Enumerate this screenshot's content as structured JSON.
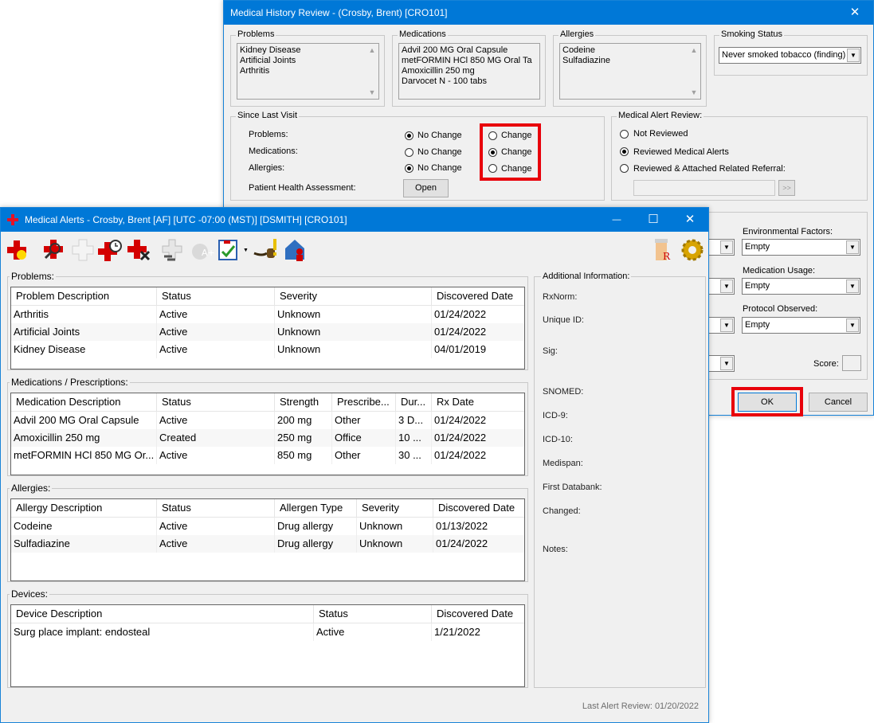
{
  "review": {
    "title": "Medical History Review - (Crosby, Brent) [CRO101]",
    "close_glyph": "✕",
    "problems": {
      "legend": "Problems",
      "items": [
        "Kidney Disease",
        "Artificial Joints",
        "Arthritis"
      ]
    },
    "medications": {
      "legend": "Medications",
      "items": [
        "Advil 200 MG Oral Capsule",
        "metFORMIN HCl 850 MG Oral Ta",
        "Amoxicillin 250 mg",
        "Darvocet N - 100 tabs"
      ]
    },
    "allergies": {
      "legend": "Allergies",
      "items": [
        "Codeine",
        "Sulfadiazine"
      ]
    },
    "smoking": {
      "legend": "Smoking Status",
      "value": "Never smoked tobacco (finding)"
    },
    "since_last_visit": {
      "legend": "Since Last Visit",
      "rows": [
        {
          "label": "Problems:",
          "no_change": "No Change",
          "change": "Change",
          "selected": "no_change"
        },
        {
          "label": "Medications:",
          "no_change": "No Change",
          "change": "Change",
          "selected": "change"
        },
        {
          "label": "Allergies:",
          "no_change": "No Change",
          "change": "Change",
          "selected": "no_change"
        }
      ],
      "pha_label": "Patient Health Assessment:",
      "open_button": "Open"
    },
    "alert_review": {
      "legend": "Medical Alert Review:",
      "options": [
        "Not Reviewed",
        "Reviewed Medical Alerts",
        "Reviewed & Attached Related Referral:"
      ],
      "selected": 1,
      "browse_glyph": ">>"
    },
    "env": {
      "label": "Environmental Factors:",
      "value": "Empty"
    },
    "med_usage": {
      "label": "Medication Usage:",
      "value": "Empty"
    },
    "protocol": {
      "label": "Protocol Observed:",
      "value": "Empty"
    },
    "score_label": "Score:",
    "ok_button": "OK",
    "cancel_button": "Cancel"
  },
  "alerts": {
    "title": "Medical Alerts - Crosby, Brent [AF] [UTC -07:00 (MST)] [DSMITH] [CRO101]",
    "minimize_glyph": "—",
    "maximize_glyph": "☐",
    "close_glyph": "✕",
    "toolbar_icons": [
      "add-alert-icon",
      "search-alert-icon",
      "blank-cross-icon",
      "alert-history-icon",
      "delete-alert-icon",
      "link-icon",
      "apple-grade-icon",
      "checklist-icon",
      "pipe-icon",
      "warning-icon",
      "home-person-icon"
    ],
    "right_icons": [
      "rx-bottle-icon",
      "settings-gear-icon"
    ],
    "problems": {
      "legend": "Problems:",
      "headers": [
        "Problem Description",
        "Status",
        "Severity",
        "Discovered Date"
      ],
      "rows": [
        [
          "Arthritis",
          "Active",
          "Unknown",
          "01/24/2022"
        ],
        [
          "Artificial Joints",
          "Active",
          "Unknown",
          "01/24/2022"
        ],
        [
          "Kidney Disease",
          "Active",
          "Unknown",
          "04/01/2019"
        ]
      ]
    },
    "medications": {
      "legend": "Medications / Prescriptions:",
      "headers": [
        "Medication Description",
        "Status",
        "Strength",
        "Prescribe...",
        "Dur...",
        "Rx Date"
      ],
      "rows": [
        [
          "Advil 200 MG Oral Capsule",
          "Active",
          "200 mg",
          "Other",
          "3 D...",
          "01/24/2022"
        ],
        [
          "Amoxicillin 250 mg",
          "Created",
          "250 mg",
          "Office",
          "10 ...",
          "01/24/2022"
        ],
        [
          "metFORMIN HCl 850 MG Or...",
          "Active",
          "850 mg",
          "Other",
          "30 ...",
          "01/24/2022"
        ]
      ]
    },
    "allergies": {
      "legend": "Allergies:",
      "headers": [
        "Allergy Description",
        "Status",
        "Allergen Type",
        "Severity",
        "Discovered Date"
      ],
      "rows": [
        [
          "Codeine",
          "Active",
          "Drug allergy",
          "Unknown",
          "01/13/2022"
        ],
        [
          "Sulfadiazine",
          "Active",
          "Drug allergy",
          "Unknown",
          "01/24/2022"
        ]
      ]
    },
    "devices": {
      "legend": "Devices:",
      "headers": [
        "Device Description",
        "Status",
        "Discovered Date"
      ],
      "rows": [
        [
          "Surg place implant: endosteal",
          "Active",
          "1/21/2022"
        ]
      ]
    },
    "info": {
      "legend": "Additional Information:",
      "labels": [
        "RxNorm:",
        "Unique ID:",
        "Sig:",
        "SNOMED:",
        "ICD-9:",
        "ICD-10:",
        "Medispan:",
        "First Databank:",
        "Changed:",
        "Notes:"
      ]
    },
    "last_review": "Last Alert Review: 01/20/2022"
  },
  "colors": {
    "titlebar": "#0078d7",
    "highlight": "#e8000b",
    "alert_red": "#d40000"
  }
}
